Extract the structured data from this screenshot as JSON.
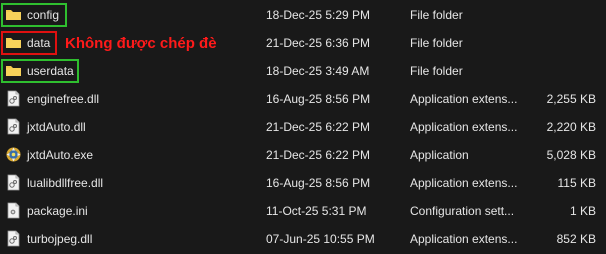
{
  "annotation": "Không được chép đè",
  "colors": {
    "background": "#191919",
    "text": "#e6e6e6",
    "folder": "#f3c94d",
    "highlight_green": "#2fbf2f",
    "highlight_red": "#e01010",
    "annotation": "#ff1a1a"
  },
  "files": [
    {
      "name": "config",
      "date": "18-Dec-25 5:29 PM",
      "type": "File folder",
      "size": "",
      "icon": "folder-icon"
    },
    {
      "name": "data",
      "date": "21-Dec-25 6:36 PM",
      "type": "File folder",
      "size": "",
      "icon": "folder-icon"
    },
    {
      "name": "userdata",
      "date": "18-Dec-25 3:49 AM",
      "type": "File folder",
      "size": "",
      "icon": "folder-icon"
    },
    {
      "name": "enginefree.dll",
      "date": "16-Aug-25 8:56 PM",
      "type": "Application extens...",
      "size": "2,255 KB",
      "icon": "dll-file-icon"
    },
    {
      "name": "jxtdAuto.dll",
      "date": "21-Dec-25 6:22 PM",
      "type": "Application extens...",
      "size": "2,220 KB",
      "icon": "dll-file-icon"
    },
    {
      "name": "jxtdAuto.exe",
      "date": "21-Dec-25 6:22 PM",
      "type": "Application",
      "size": "5,028 KB",
      "icon": "exe-app-icon"
    },
    {
      "name": "lualibdllfree.dll",
      "date": "16-Aug-25 8:56 PM",
      "type": "Application extens...",
      "size": "115 KB",
      "icon": "dll-file-icon"
    },
    {
      "name": "package.ini",
      "date": "11-Oct-25 5:31 PM",
      "type": "Configuration sett...",
      "size": "1 KB",
      "icon": "ini-file-icon"
    },
    {
      "name": "turbojpeg.dll",
      "date": "07-Jun-25 10:55 PM",
      "type": "Application extens...",
      "size": "852 KB",
      "icon": "dll-file-icon"
    }
  ]
}
